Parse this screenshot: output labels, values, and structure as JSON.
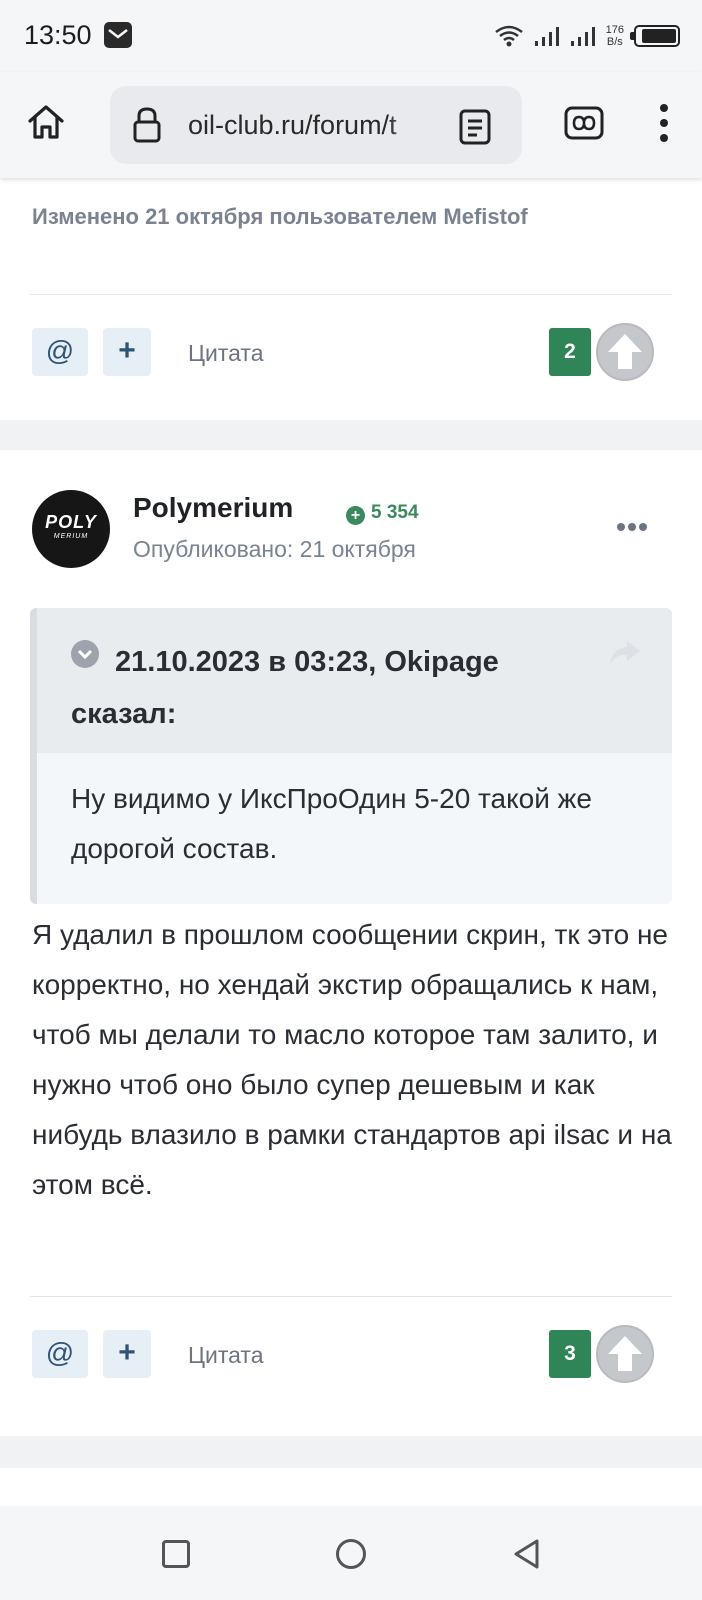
{
  "status_bar": {
    "time": "13:50",
    "net_speed_value": "176",
    "net_speed_unit": "B/s",
    "icons": [
      "mail-icon",
      "wifi-icon",
      "signal-icon",
      "signal-icon",
      "battery-icon"
    ]
  },
  "browser": {
    "url": "oil-club.ru/forum/t",
    "icons": [
      "home-icon",
      "lock-icon",
      "reader-mode-icon",
      "tabs-icon",
      "more-vert-icon"
    ]
  },
  "previous_post": {
    "edited_note": "Изменено 21 октября пользователем Mefistof",
    "mention_label": "@",
    "plus_label": "+",
    "quote_label": "Цитата",
    "reputation": "2"
  },
  "post": {
    "avatar_text": "POLY",
    "avatar_subtext": "MERIUM",
    "author": "Polymerium",
    "reputation_badge": "5 354",
    "published": "Опубликовано: 21 октября",
    "quote": {
      "header": "21.10.2023 в 03:23, Okipage сказал:",
      "body": "Ну видимо у ИксПроОдин 5-20 такой же дорогой состав."
    },
    "text": "Я удалил в прошлом сообщении скрин, тк это не корректно, но хендай экстир обращались к нам, чтоб мы делали то масло которое там залито, и нужно чтоб оно было супер дешевым и как нибудь влазило в рамки стандартов api ilsac и на этом всё.",
    "mention_label": "@",
    "plus_label": "+",
    "quote_label": "Цитата",
    "reputation": "3"
  },
  "colors": {
    "reputation_green": "#2f8558",
    "button_bg": "#e6eef6",
    "muted_text": "#7a8391"
  }
}
